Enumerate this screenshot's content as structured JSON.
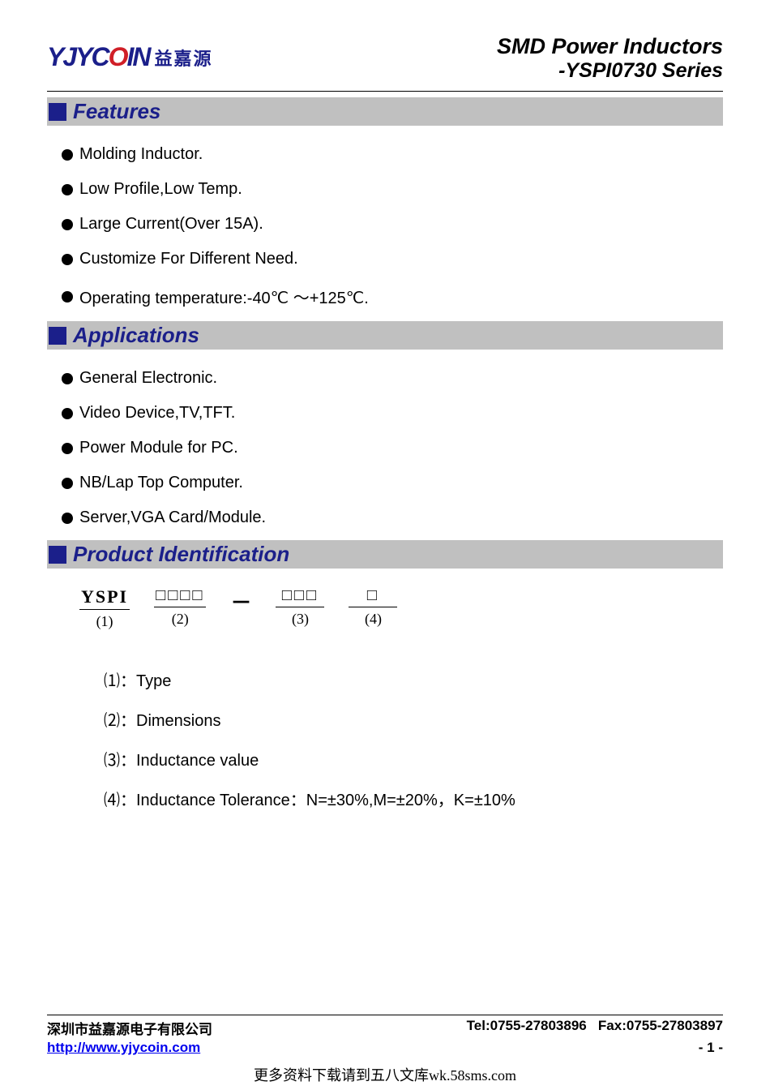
{
  "header": {
    "logo_en_prefix": "YJYC",
    "logo_en_red": "O",
    "logo_en_suffix": "IN",
    "logo_cn": "益嘉源",
    "title_line1": "SMD Power Inductors",
    "title_line2": "-YSPI0730 Series"
  },
  "sections": {
    "features": "Features",
    "applications": "Applications",
    "product_id": "Product Identification"
  },
  "features": [
    "Molding Inductor.",
    "Low Profile,Low Temp.",
    "Large Current(Over 15A).",
    "Customize For Different Need.",
    "Operating temperature:-40℃ ～+125℃."
  ],
  "applications": [
    "General Electronic.",
    "Video Device,TV,TFT.",
    "Power Module for PC.",
    "NB/Lap Top Computer.",
    "Server,VGA Card/Module."
  ],
  "pid": {
    "cols": [
      {
        "top": "YSPI",
        "bottom": "(1)"
      },
      {
        "top": "□□□□",
        "bottom": "(2)"
      },
      {
        "dash": "－"
      },
      {
        "top": "□□□",
        "bottom": "(3)"
      },
      {
        "top": "□",
        "bottom": "(4)"
      }
    ],
    "defs": [
      {
        "num": "⑴",
        "text": "：Type"
      },
      {
        "num": "⑵",
        "text": "：Dimensions"
      },
      {
        "num": "⑶",
        "text": "：Inductance value"
      },
      {
        "num": "⑷",
        "text": "：Inductance Tolerance：N=±30%,M=±20%，K=±10%"
      }
    ]
  },
  "footer": {
    "company": "深圳市益嘉源电子有限公司",
    "tel": "Tel:0755-27803896",
    "fax": "Fax:0755-27803897",
    "url": "http://www.yjycoin.com",
    "page": "- 1 -",
    "watermark": "更多资料下载请到五八文库wk.58sms.com"
  }
}
